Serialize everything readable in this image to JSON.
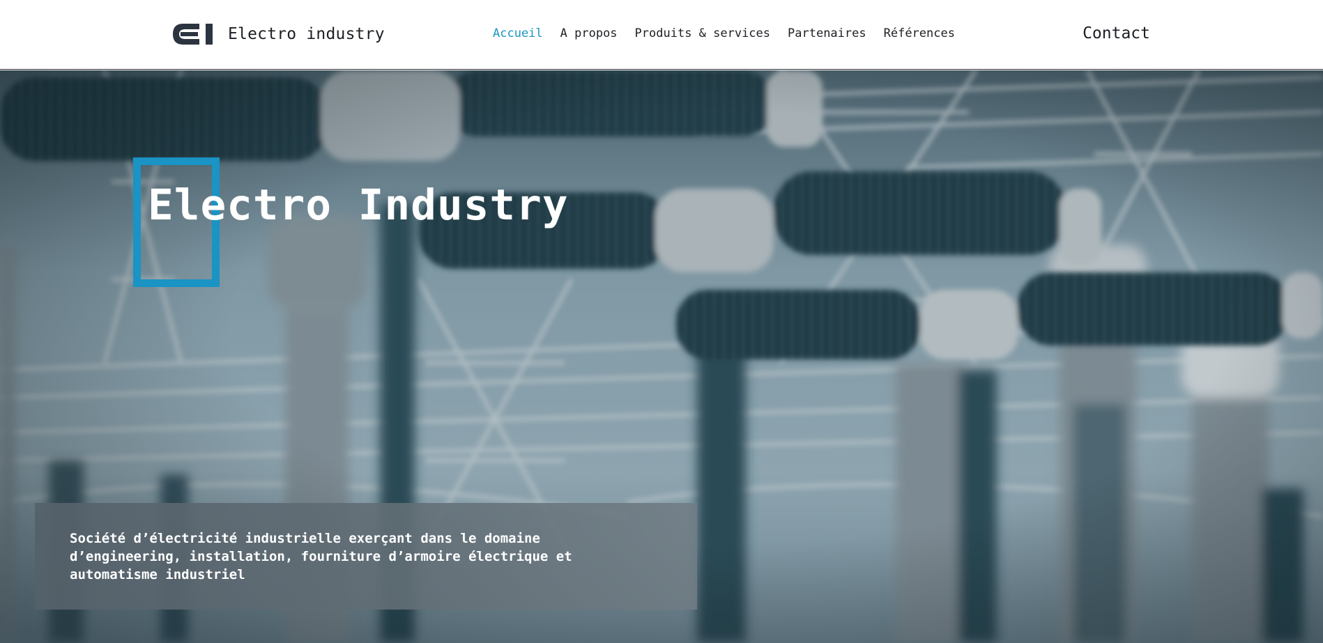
{
  "header": {
    "logo_icon": "ei-monogram-icon",
    "brand_name": "Electro industry",
    "nav": [
      {
        "label": "Accueil",
        "active": true
      },
      {
        "label": "A propos",
        "active": false
      },
      {
        "label": "Produits & services",
        "active": false
      },
      {
        "label": "Partenaires",
        "active": false
      },
      {
        "label": "Références",
        "active": false
      }
    ],
    "contact_label": "Contact"
  },
  "hero": {
    "title": "Electro Industry",
    "description": "Société d’électricité industrielle exerçant dans le domaine d’engineering, installation, fourniture d’armoire électrique et automatisme industriel"
  },
  "colors": {
    "accent": "#1a96c2",
    "text_dark": "#1c1f24",
    "hero_frame": "#1a93c5"
  }
}
